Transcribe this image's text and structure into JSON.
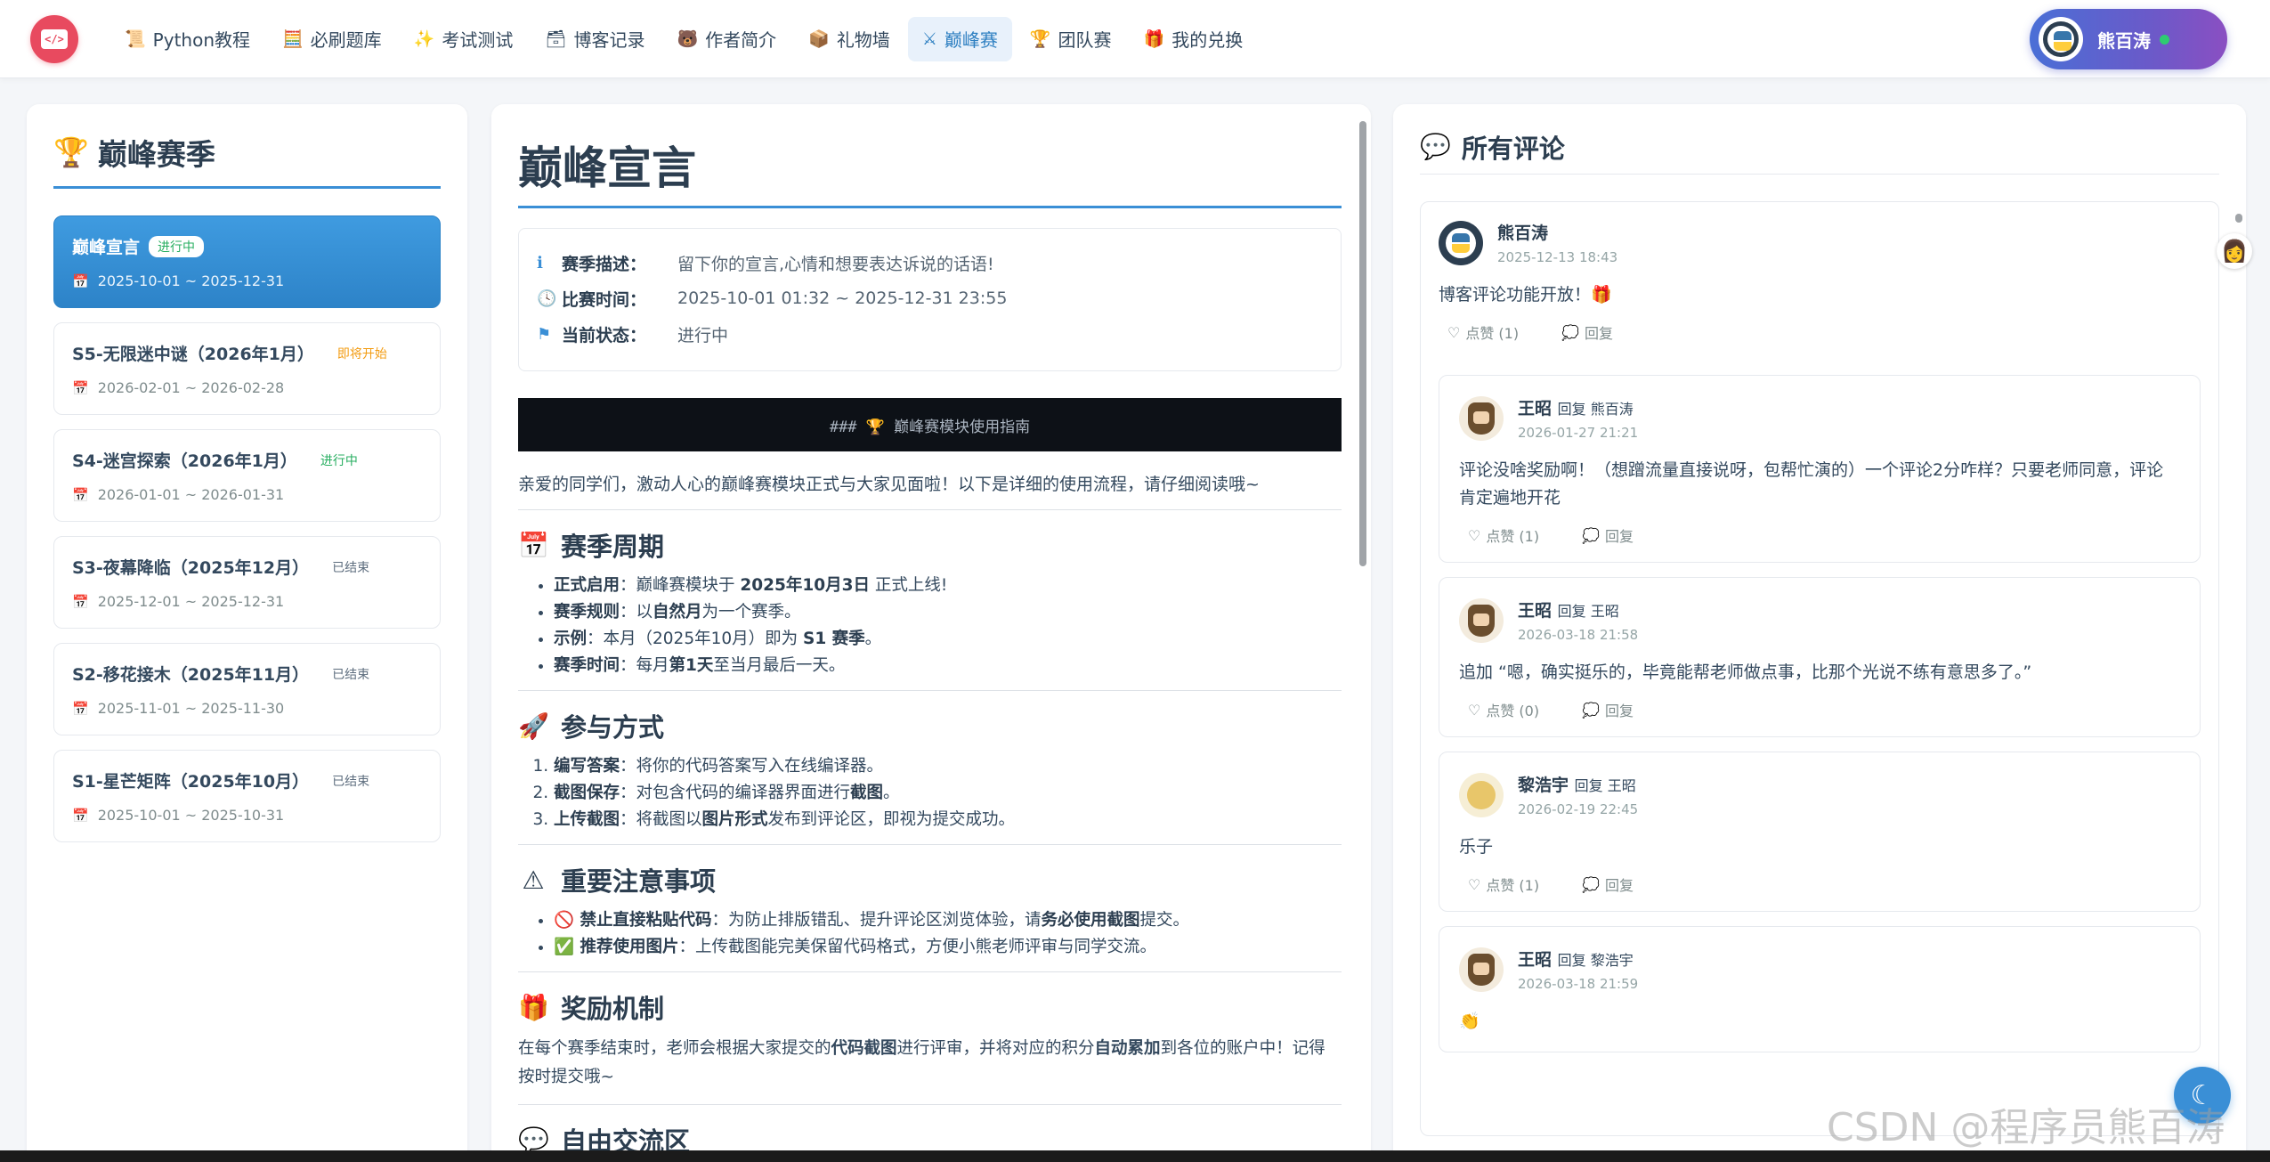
{
  "nav": {
    "logo_text": "</>",
    "items": [
      {
        "icon": "📜",
        "label": "Python教程"
      },
      {
        "icon": "🧮",
        "label": "必刷题库"
      },
      {
        "icon": "✨",
        "label": "考试测试"
      },
      {
        "icon": "🗃",
        "label": "博客记录"
      },
      {
        "icon": "🐻",
        "label": "作者简介"
      },
      {
        "icon": "📦",
        "label": "礼物墙"
      },
      {
        "icon": "⚔",
        "label": "巅峰赛"
      },
      {
        "icon": "🏆",
        "label": "团队赛"
      },
      {
        "icon": "🎁",
        "label": "我的兑换"
      }
    ],
    "active_index": 6,
    "user_name": "熊百涛"
  },
  "seasons": {
    "title": "巅峰赛季",
    "items": [
      {
        "name": "巅峰宣言",
        "tag": "进行中",
        "status": "running",
        "date": "2025-10-01 ~ 2025-12-31",
        "active": true
      },
      {
        "name": "S5-无限迷中谜（2026年1月）",
        "tag": "即将开始",
        "status": "upcoming",
        "date": "2026-02-01 ~ 2026-02-28",
        "active": false
      },
      {
        "name": "S4-迷宫探索（2026年1月）",
        "tag": "进行中",
        "status": "running",
        "date": "2026-01-01 ~ 2026-01-31",
        "active": false
      },
      {
        "name": "S3-夜幕降临（2025年12月）",
        "tag": "已结束",
        "status": "ended",
        "date": "2025-12-01 ~ 2025-12-31",
        "active": false
      },
      {
        "name": "S2-移花接木（2025年11月）",
        "tag": "已结束",
        "status": "ended",
        "date": "2025-11-01 ~ 2025-11-30",
        "active": false
      },
      {
        "name": "S1-星芒矩阵（2025年10月）",
        "tag": "已结束",
        "status": "ended",
        "date": "2025-10-01 ~ 2025-10-31",
        "active": false
      }
    ]
  },
  "main": {
    "title": "巅峰宣言",
    "info": [
      {
        "icon": "ℹ",
        "key": "赛季描述：",
        "value": "留下你的宣言,心情和想要表达诉说的话语!"
      },
      {
        "icon": "🕓",
        "key": "比赛时间：",
        "value": "2025-10-01 01:32 ~ 2025-12-31 23:55"
      },
      {
        "icon": "⚑",
        "key": "当前状态：",
        "value": "进行中"
      }
    ],
    "code_bar": "###  🏆  巅峰赛模块使用指南",
    "intro": "亲爱的同学们，激动人心的巅峰赛模块正式与大家见面啦！以下是详细的使用流程，请仔细阅读哦~",
    "sections": [
      {
        "icon": "📅",
        "title": "赛季周期",
        "items": [
          {
            "b": "正式启用",
            "t": "：巅峰赛模块于 ",
            "b2": "2025年10月3日",
            "t2": " 正式上线!"
          },
          {
            "b": "赛季规则",
            "t": "：以",
            "b2": "自然月",
            "t2": "为一个赛季。"
          },
          {
            "b": "示例",
            "t": "：本月（2025年10月）即为 ",
            "b2": "S1 赛季",
            "t2": "。"
          },
          {
            "b": "赛季时间",
            "t": "：每月",
            "b2": "第1天",
            "t2": "至当月最后一天。"
          }
        ]
      },
      {
        "icon": "🚀",
        "title": "参与方式",
        "items": [
          {
            "b": "编写答案",
            "t": "：将你的代码答案写入在线编译器。",
            "b2": "",
            "t2": ""
          },
          {
            "b": "截图保存",
            "t": "：对包含代码的编译器界面进行",
            "b2": "截图",
            "t2": "。"
          },
          {
            "b": "上传截图",
            "t": "：将截图以",
            "b2": "图片形式",
            "t2": "发布到评论区，即视为提交成功。"
          }
        ]
      },
      {
        "icon": "⚠",
        "title": "重要注意事项",
        "items": [
          {
            "b": "🚫 禁止直接粘贴代码",
            "t": "：为防止排版错乱、提升评论区浏览体验，请",
            "b2": "务必使用截图",
            "t2": "提交。"
          },
          {
            "b": "✅ 推荐使用图片",
            "t": "：上传截图能完美保留代码格式，方便小熊老师评审与同学交流。",
            "b2": "",
            "t2": ""
          }
        ]
      }
    ],
    "reward": {
      "icon": "🎁",
      "title": "奖励机制",
      "p1": "在每个赛季结束时，老师会根据大家提交的",
      "b1": "代码截图",
      "p2": "进行评审，并将对应的积分",
      "b2": "自动累加",
      "p3": "到各位的账户中！记得按时提交哦~"
    },
    "next_section": {
      "icon": "💬",
      "title": "自由交流区"
    }
  },
  "comments": {
    "title": "所有评论",
    "top": {
      "name": "熊百涛",
      "time": "2025-12-13 18:43",
      "body": "博客评论功能开放！🎁",
      "like": "点赞 (1)",
      "reply": "回复"
    },
    "replies": [
      {
        "avatar": "warrior",
        "name": "王昭",
        "reply_to": "回复 熊百涛",
        "time": "2026-01-27 21:21",
        "body": "评论没啥奖励啊！（想蹭流量直接说呀，包帮忙演的）一个评论2分咋样？只要老师同意，评论肯定遍地开花",
        "like": "点赞 (1)",
        "reply": "回复"
      },
      {
        "avatar": "warrior",
        "name": "王昭",
        "reply_to": "回复 王昭",
        "time": "2026-03-18 21:58",
        "body": "追加 “嗯，确实挺乐的，毕竟能帮老师做点事，比那个光说不练有意思多了。”",
        "like": "点赞 (0)",
        "reply": "回复"
      },
      {
        "avatar": "cat",
        "name": "黎浩宇",
        "reply_to": "回复 王昭",
        "time": "2026-02-19 22:45",
        "body": "乐子",
        "like": "点赞 (1)",
        "reply": "回复"
      },
      {
        "avatar": "warrior",
        "name": "王昭",
        "reply_to": "回复 黎浩宇",
        "time": "2026-03-18 21:59",
        "body": "👏",
        "like": "",
        "reply": ""
      }
    ]
  },
  "watermark": "CSDN @程序员熊百涛",
  "colors": {
    "accent": "#3a8fd6",
    "logo": "#e84a5f",
    "running": "#27ae60",
    "upcoming": "#f39c12"
  }
}
